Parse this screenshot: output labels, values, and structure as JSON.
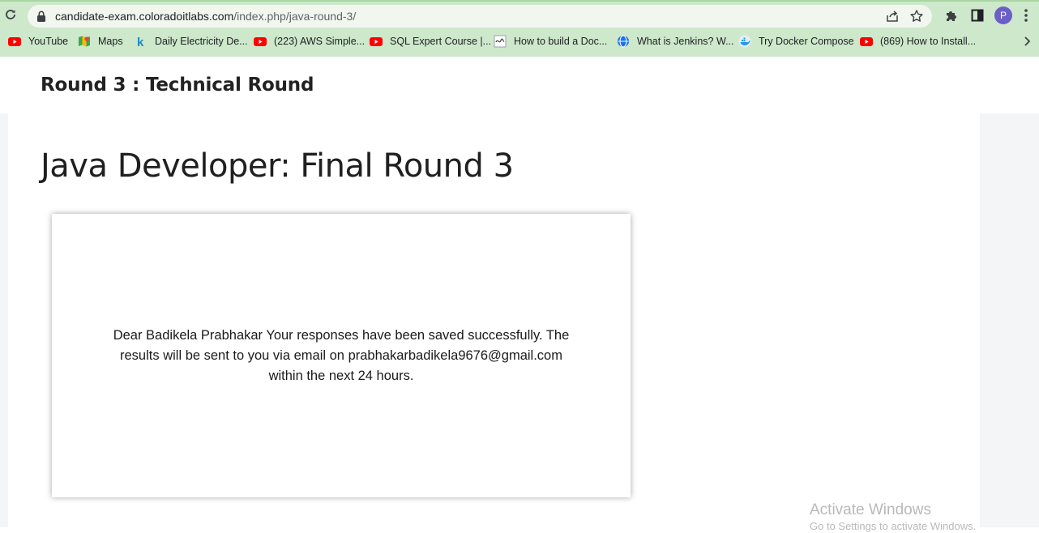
{
  "browser": {
    "url_host": "candidate-exam.coloradoitlabs.com",
    "url_path": "/index.php/java-round-3/",
    "profile_initial": "P",
    "bookmarks": [
      {
        "label": "YouTube",
        "icon": "youtube-icon"
      },
      {
        "label": "Maps",
        "icon": "maps-icon"
      },
      {
        "label": "Daily Electricity De...",
        "icon": "k-icon"
      },
      {
        "label": "(223) AWS Simple...",
        "icon": "youtube-icon"
      },
      {
        "label": "SQL Expert Course |...",
        "icon": "youtube-icon"
      },
      {
        "label": "How to build a Doc...",
        "icon": "doc-icon"
      },
      {
        "label": "What is Jenkins? W...",
        "icon": "globe-icon"
      },
      {
        "label": "Try Docker Compose",
        "icon": "docker-icon"
      },
      {
        "label": "(869) How to Install...",
        "icon": "youtube-icon"
      }
    ]
  },
  "page": {
    "site_title": "Round 3 : Technical Round",
    "heading": "Java Developer: Final Round 3",
    "message": "Dear Badikela Prabhakar Your responses have been saved successfully. The results will be sent to you via email on prabhakarbadikela9676@gmail.com within the next 24 hours."
  },
  "watermark": {
    "line1": "Activate Windows",
    "line2": "Go to Settings to activate Windows."
  }
}
